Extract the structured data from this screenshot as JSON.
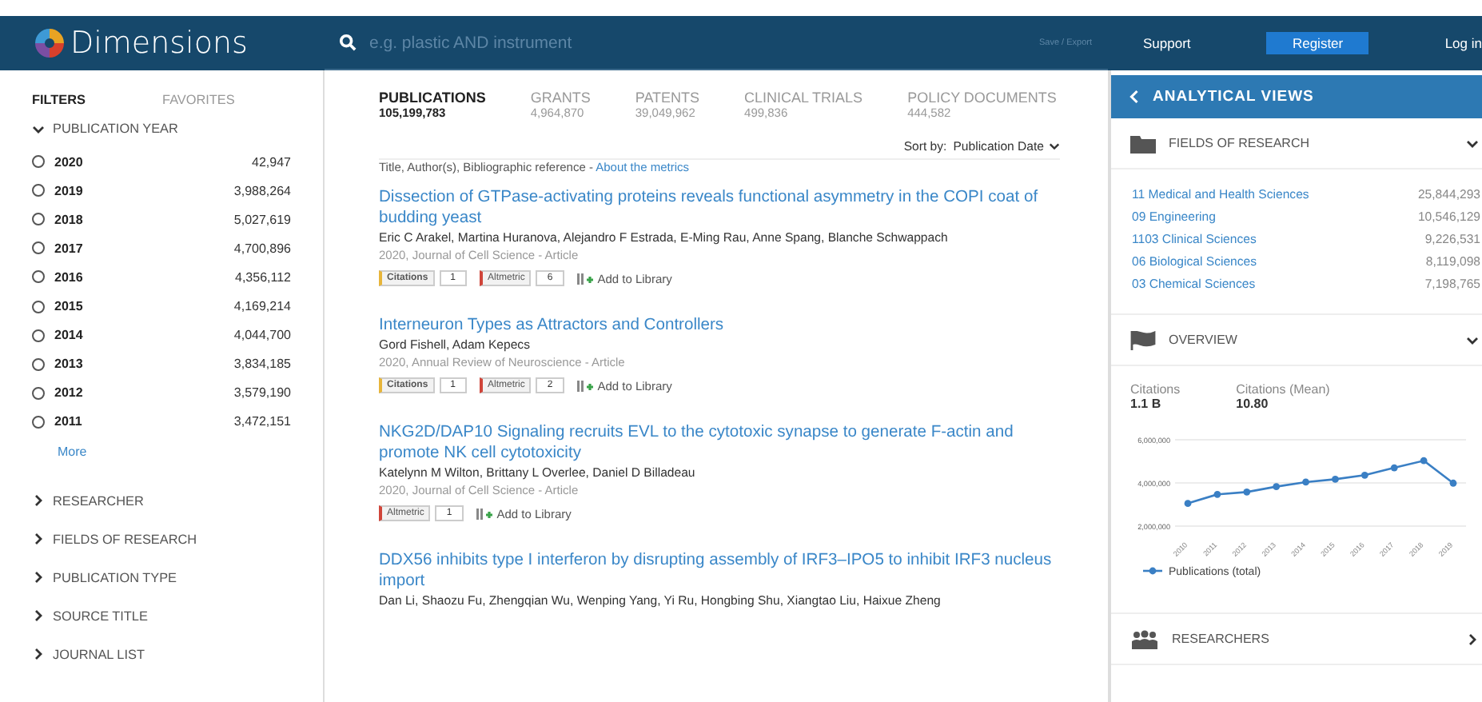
{
  "header": {
    "logo_text": "Dimensions",
    "search_placeholder": "e.g. plastic AND instrument",
    "save_export": "Save / Export",
    "nav": [
      {
        "label": "Support",
        "kind": "link"
      },
      {
        "label": "Register",
        "kind": "button"
      },
      {
        "label": "Log in",
        "kind": "link"
      }
    ]
  },
  "sidebar": {
    "tabs": [
      {
        "label": "FILTERS",
        "selected": true
      },
      {
        "label": "FAVORITES",
        "selected": false
      }
    ],
    "year_filter": {
      "title": "PUBLICATION YEAR",
      "expanded": true,
      "more": "More",
      "options": [
        {
          "label": "2020",
          "count": "42,947",
          "selected": false
        },
        {
          "label": "2019",
          "count": "3,988,264",
          "selected": false
        },
        {
          "label": "2018",
          "count": "5,027,619",
          "selected": false
        },
        {
          "label": "2017",
          "count": "4,700,896",
          "selected": false
        },
        {
          "label": "2016",
          "count": "4,356,112",
          "selected": false
        },
        {
          "label": "2015",
          "count": "4,169,214",
          "selected": false
        },
        {
          "label": "2014",
          "count": "4,044,700",
          "selected": false
        },
        {
          "label": "2013",
          "count": "3,834,185",
          "selected": false
        },
        {
          "label": "2012",
          "count": "3,579,190",
          "selected": false
        },
        {
          "label": "2011",
          "count": "3,472,151",
          "selected": false
        }
      ]
    },
    "sections": [
      {
        "label": "RESEARCHER",
        "expanded": false
      },
      {
        "label": "FIELDS OF RESEARCH",
        "expanded": false
      },
      {
        "label": "PUBLICATION TYPE",
        "expanded": false
      },
      {
        "label": "SOURCE TITLE",
        "expanded": false
      },
      {
        "label": "JOURNAL LIST",
        "expanded": false
      }
    ]
  },
  "main": {
    "tabs": [
      {
        "label": "PUBLICATIONS",
        "count": "105,199,783",
        "selected": true
      },
      {
        "label": "GRANTS",
        "count": "4,964,870",
        "selected": false
      },
      {
        "label": "PATENTS",
        "count": "39,049,962",
        "selected": false
      },
      {
        "label": "CLINICAL TRIALS",
        "count": "499,836",
        "selected": false
      },
      {
        "label": "POLICY DOCUMENTS",
        "count": "444,582",
        "selected": false
      }
    ],
    "sort_label": "Sort by:",
    "sort_value": "Publication Date",
    "columns_note": "Title, Author(s), Bibliographic reference - ",
    "metrics_link": "About the metrics",
    "results": [
      {
        "title": "Dissection of GTPase-activating proteins reveals functional asymmetry in the COPI coat of budding yeast",
        "authors": "Eric C Arakel, Martina Huranova, Alejandro F Estrada, E-Ming Rau, Anne Spang, Blanche Schwappach",
        "reference": "2020, Journal of Cell Science - Article",
        "badges": [
          {
            "kind": "citations",
            "label": "Citations",
            "count": "1"
          },
          {
            "kind": "altmetric",
            "label": "Altmetric",
            "count": "6"
          }
        ],
        "add_label": "Add to Library"
      },
      {
        "title": "Interneuron Types as Attractors and Controllers",
        "authors": "Gord Fishell, Adam Kepecs",
        "reference": "2020, Annual Review of Neuroscience - Article",
        "badges": [
          {
            "kind": "citations",
            "label": "Citations",
            "count": "1"
          },
          {
            "kind": "altmetric",
            "label": "Altmetric",
            "count": "2"
          }
        ],
        "add_label": "Add to Library"
      },
      {
        "title": "NKG2D/DAP10 Signaling recruits EVL to the cytotoxic synapse to generate F-actin and promote NK cell cytotoxicity",
        "authors": "Katelynn M Wilton, Brittany L Overlee, Daniel D Billadeau",
        "reference": "2020, Journal of Cell Science - Article",
        "badges": [
          {
            "kind": "altmetric",
            "label": "Altmetric",
            "count": "1"
          }
        ],
        "add_label": "Add to Library"
      },
      {
        "title": "DDX56 inhibits type I interferon by disrupting assembly of IRF3–IPO5 to inhibit IRF3 nucleus import",
        "authors": "Dan Li, Shaozu Fu, Zhengqian Wu, Wenping Yang, Yi Ru, Hongbing Shu, Xiangtao Liu, Haixue Zheng"
      }
    ]
  },
  "analytics": {
    "title": "ANALYTICAL VIEWS",
    "fields": {
      "title": "FIELDS OF RESEARCH",
      "expanded": true,
      "items": [
        {
          "name": "11 Medical and Health Sciences",
          "count": "25,844,293"
        },
        {
          "name": "09 Engineering",
          "count": "10,546,129"
        },
        {
          "name": "1103 Clinical Sciences",
          "count": "9,226,531"
        },
        {
          "name": "06 Biological Sciences",
          "count": "8,119,098"
        },
        {
          "name": "03 Chemical Sciences",
          "count": "7,198,765"
        }
      ]
    },
    "overview": {
      "title": "OVERVIEW",
      "expanded": true,
      "stats": [
        {
          "label": "Citations",
          "value": "1.1 B"
        },
        {
          "label": "Citations (Mean)",
          "value": "10.80"
        }
      ],
      "chart_data": {
        "type": "line",
        "categories": [
          "2010",
          "2011",
          "2012",
          "2013",
          "2014",
          "2015",
          "2016",
          "2017",
          "2018",
          "2019"
        ],
        "series": [
          {
            "name": "Publications (total)",
            "color": "#3a7fc4",
            "marker": "circle",
            "values": [
              3050000,
              3470000,
              3580000,
              3830000,
              4040000,
              4170000,
              4360000,
              4700000,
              5030000,
              3990000
            ]
          }
        ],
        "ylim": [
          2000000,
          6000000
        ],
        "yticks": [
          {
            "value": 2000000,
            "label": "2,000,000"
          },
          {
            "value": 4000000,
            "label": "4,000,000"
          },
          {
            "value": 6000000,
            "label": "6,000,000"
          }
        ]
      }
    },
    "researchers": {
      "title": "RESEARCHERS",
      "expanded": false
    }
  }
}
